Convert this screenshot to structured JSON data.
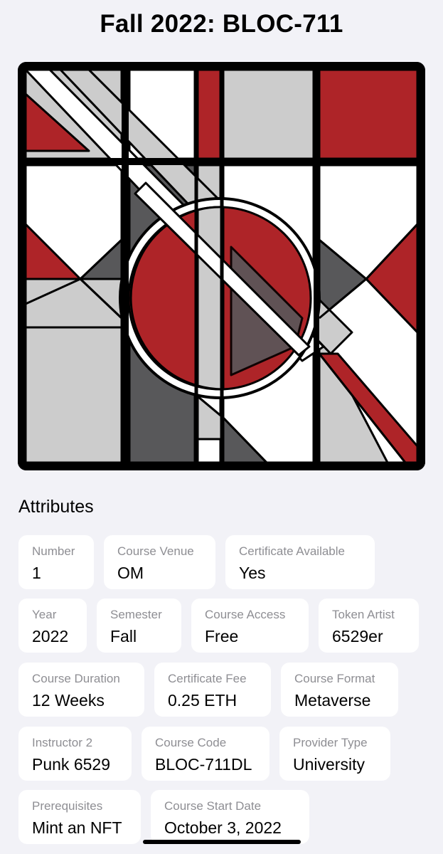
{
  "title": "Fall 2022: BLOC-711",
  "artwork": {
    "icon": "abstract-geometric-artwork",
    "colors": {
      "red": "#ae2428",
      "light_gray": "#cccccc",
      "dark_gray": "#58585a",
      "white": "#ffffff",
      "outline": "#000000"
    }
  },
  "attributes": {
    "heading": "Attributes",
    "items": [
      {
        "label": "Number",
        "value": "1"
      },
      {
        "label": "Course Venue",
        "value": "OM"
      },
      {
        "label": "Certificate Available",
        "value": "Yes"
      },
      {
        "label": "Year",
        "value": "2022"
      },
      {
        "label": "Semester",
        "value": "Fall"
      },
      {
        "label": "Course Access",
        "value": "Free"
      },
      {
        "label": "Token Artist",
        "value": "6529er"
      },
      {
        "label": "Course Duration",
        "value": "12 Weeks"
      },
      {
        "label": "Certificate Fee",
        "value": "0.25 ETH"
      },
      {
        "label": "Course Format",
        "value": "Metaverse"
      },
      {
        "label": "Instructor 2",
        "value": "Punk 6529"
      },
      {
        "label": "Course Code",
        "value": "BLOC-711DL"
      },
      {
        "label": "Provider Type",
        "value": "University"
      },
      {
        "label": "Prerequisites",
        "value": "Mint an NFT"
      },
      {
        "label": "Course Start Date",
        "value": "October 3, 2022"
      }
    ]
  }
}
